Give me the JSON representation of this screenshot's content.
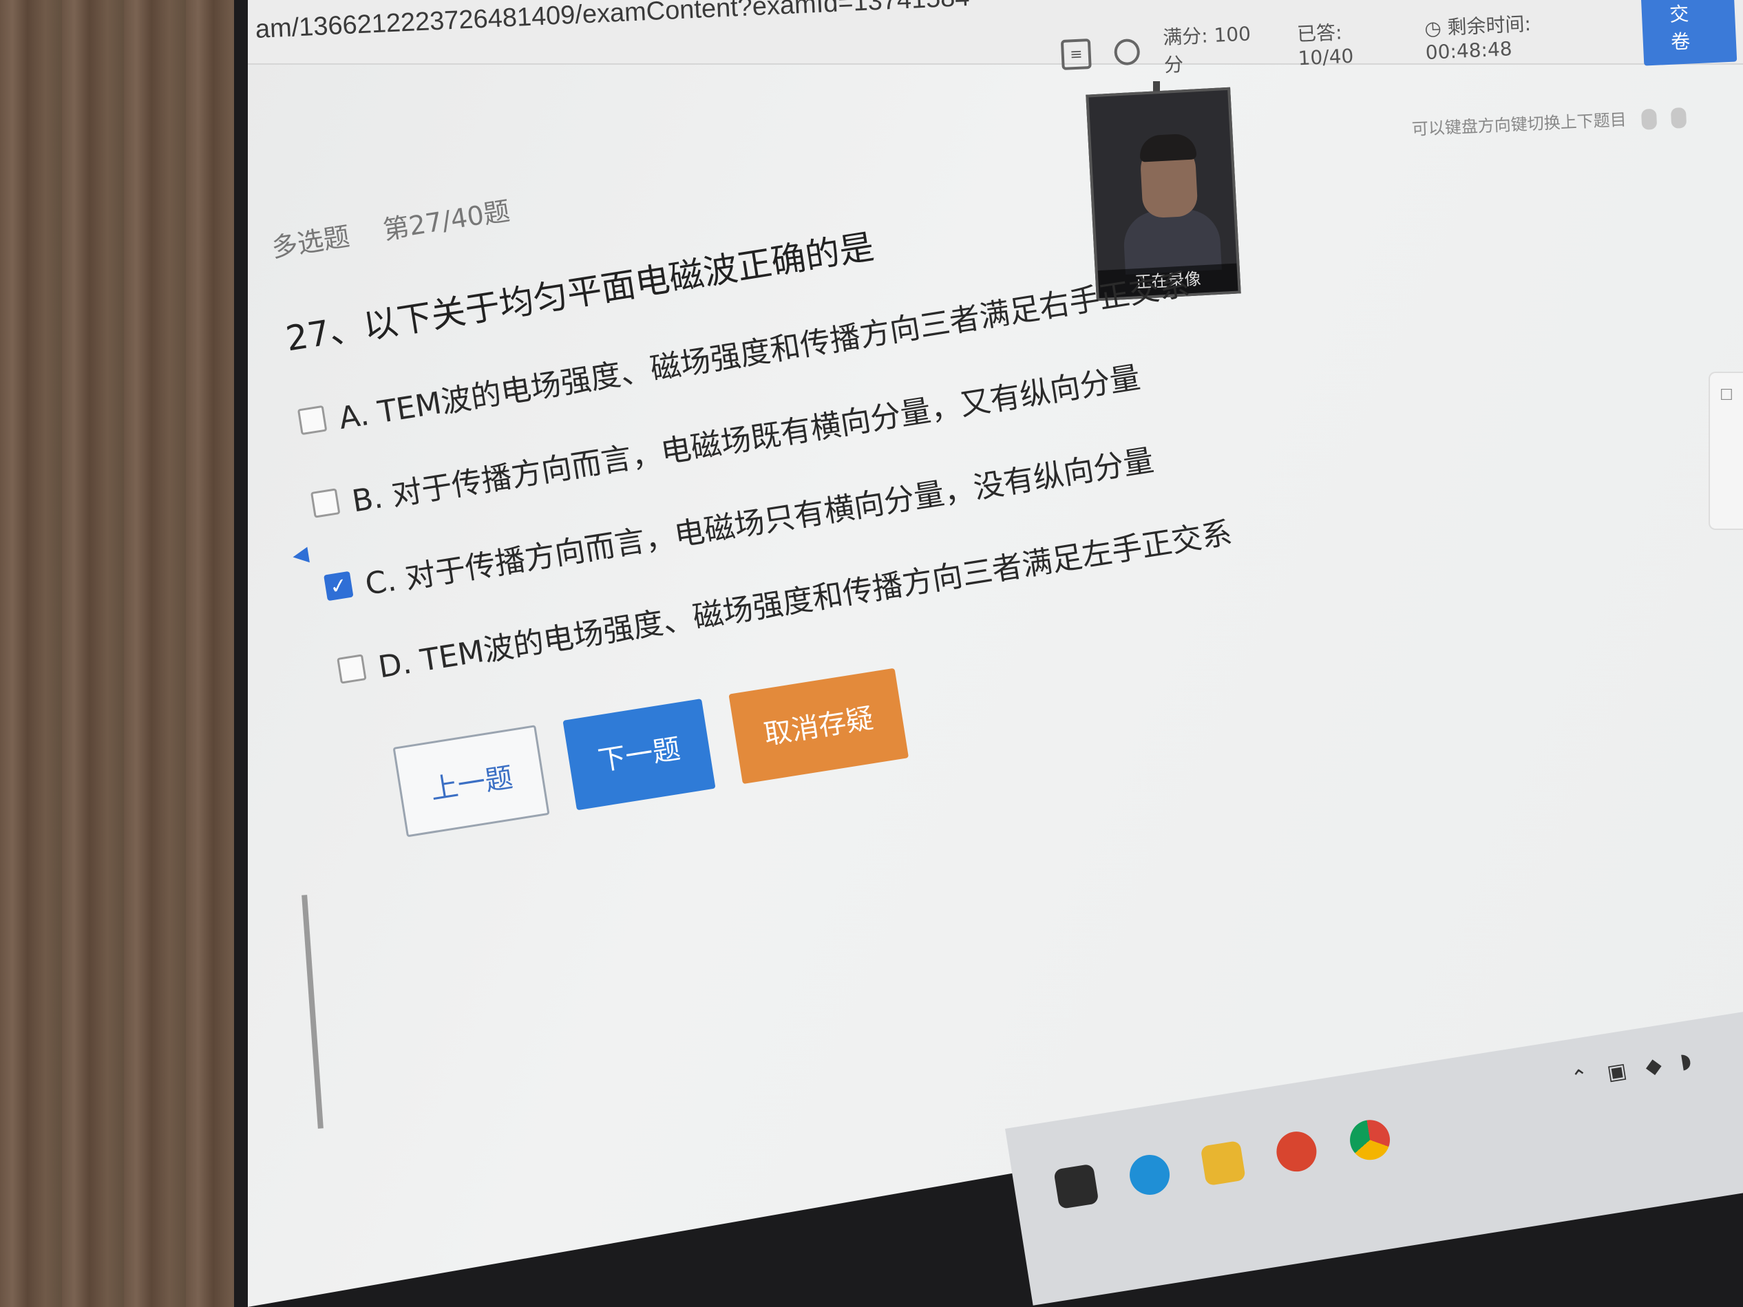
{
  "browser": {
    "url": "am/1366212223726481409/examContent?examId=13741584"
  },
  "header": {
    "full_score": "满分: 100 分",
    "answered": "已答: 10/40",
    "timer": "剩余时间: 00:48:48",
    "submit_label": "交卷",
    "hint": "可以键盘方向键切换上下题目"
  },
  "camera": {
    "label": "正在录像"
  },
  "question": {
    "type": "多选题",
    "progress": "第27/40题",
    "text": "27、以下关于均匀平面电磁波正确的是",
    "options": [
      {
        "label": "A. TEM波的电场强度、磁场强度和传播方向三者满足右手正交系",
        "checked": false
      },
      {
        "label": "B. 对于传播方向而言，电磁场既有横向分量，又有纵向分量",
        "checked": false
      },
      {
        "label": "C. 对于传播方向而言，电磁场只有横向分量，没有纵向分量",
        "checked": true
      },
      {
        "label": "D. TEM波的电场强度、磁场强度和传播方向三者满足左手正交系",
        "checked": false
      }
    ]
  },
  "nav": {
    "prev_label": "上一题",
    "next_label": "下一题",
    "mark_label": "取消存疑"
  },
  "colors": {
    "primary": "#2f7bd7",
    "mark": "#e38a3b",
    "checked": "#2f6fd6"
  }
}
